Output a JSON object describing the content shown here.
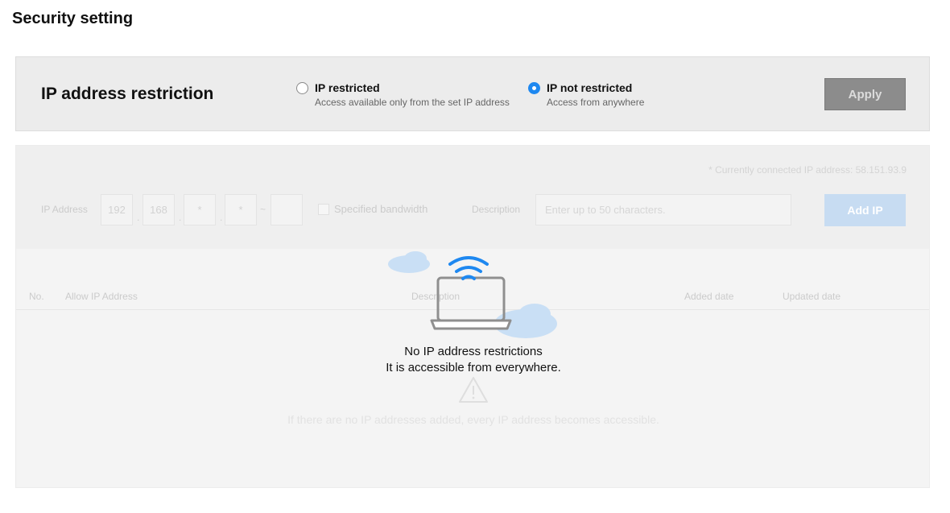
{
  "page": {
    "title": "Security setting"
  },
  "restriction": {
    "title": "IP address restriction",
    "options": [
      {
        "label": "IP restricted",
        "sub": "Access available only from the set IP address",
        "checked": false
      },
      {
        "label": "IP not restricted",
        "sub": "Access from anywhere",
        "checked": true
      }
    ],
    "apply_label": "Apply"
  },
  "add_form": {
    "connected_ip": "* Currently connected IP address: 58.151.93.9",
    "ip_label": "IP Address",
    "octets": [
      "192",
      "168",
      "*",
      "*"
    ],
    "tilde": "~",
    "bandwidth_label": "Specified bandwidth",
    "description_label": "Description",
    "description_placeholder": "Enter up to 50 characters.",
    "add_label": "Add IP"
  },
  "table": {
    "headers": [
      "No.",
      "Allow IP Address",
      "Description",
      "Added date",
      "Updated date"
    ],
    "empty_text": "If there are no IP addresses added, every IP address becomes accessible."
  },
  "overlay": {
    "line1": "No IP address restrictions",
    "line2": "It is accessible from everywhere."
  },
  "colors": {
    "accent": "#1e88f0",
    "cloud": "#c9dff5",
    "laptop": "#8f8f8f"
  },
  "icons": [
    "wifi-icon",
    "laptop-icon",
    "cloud-icon",
    "warning-icon"
  ]
}
